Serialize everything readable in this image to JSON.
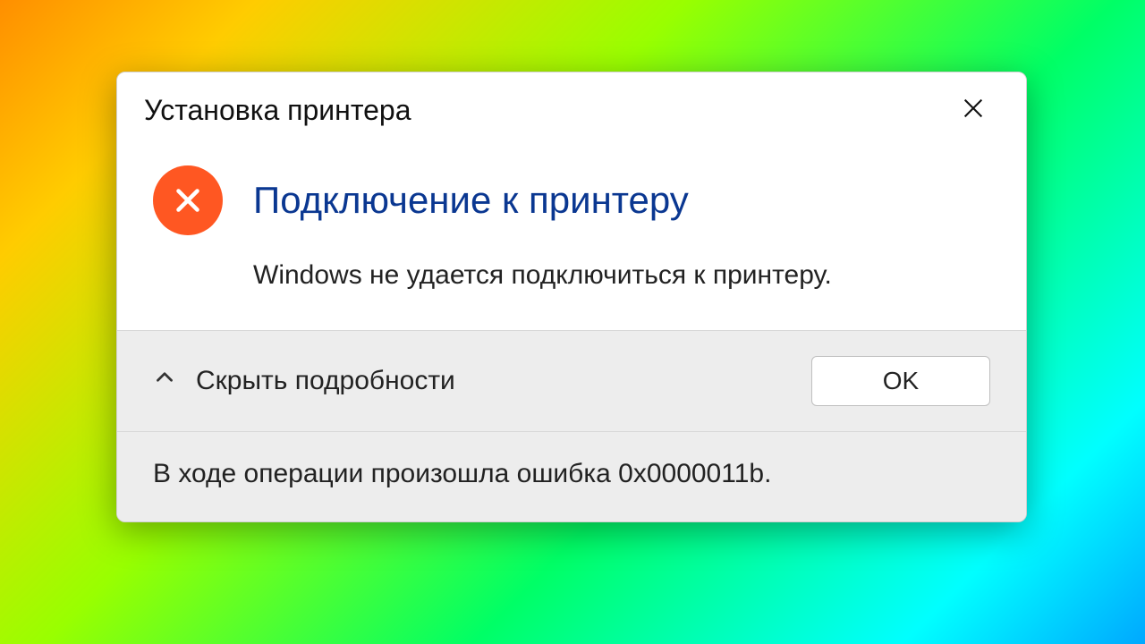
{
  "dialog": {
    "title": "Установка принтера",
    "heading": "Подключение к принтеру",
    "message": "Windows не удается подключиться к принтеру.",
    "details_toggle_label": "Скрыть подробности",
    "ok_label": "OK",
    "details_text": "В ходе операции произошла ошибка 0x0000011b."
  },
  "icons": {
    "close": "close-icon",
    "error": "error-x-icon",
    "chevron": "chevron-up-icon"
  },
  "colors": {
    "heading_blue": "#0a3791",
    "error_orange": "#ff5722",
    "footer_bg": "#ededed"
  }
}
